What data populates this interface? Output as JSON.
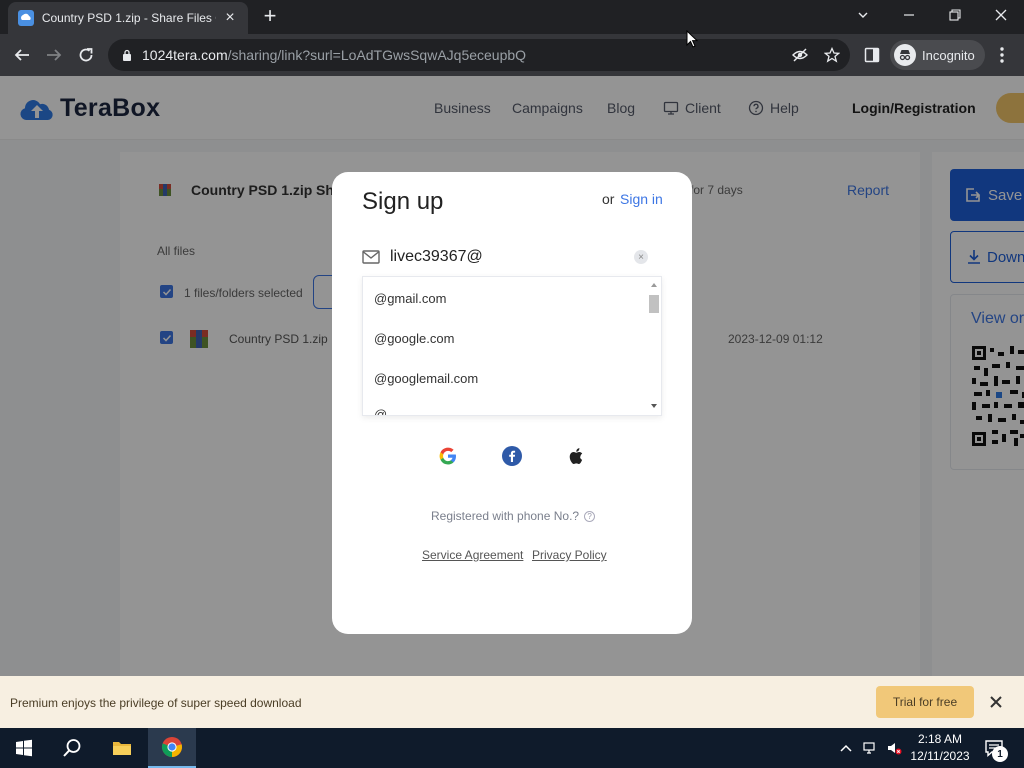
{
  "browser": {
    "tab_title": "Country PSD 1.zip - Share Files O",
    "url_host": "1024tera.com",
    "url_path": "/sharing/link?surl=LoAdTGwsSqwAJq5eceupbQ",
    "profile_label": "Incognito"
  },
  "site": {
    "brand": "TeraBox",
    "nav": {
      "business": "Business",
      "campaigns": "Campaigns",
      "blog": "Blog",
      "client": "Client",
      "help": "Help"
    },
    "login": "Login/Registration"
  },
  "share": {
    "file_title": "Country PSD 1.zip",
    "file_title_tail": "Sh",
    "expiry": "for 7 days",
    "report": "Report",
    "all_files": "All files",
    "selection": "1 files/folders selected",
    "rows": [
      {
        "name": "Country PSD 1.zip",
        "date": "2023-12-09 01:12"
      }
    ],
    "save_label": "Save",
    "download_label": "Down",
    "view_on_label": "View or"
  },
  "signup": {
    "title": "Sign up",
    "or": "or",
    "signin": "Sign in",
    "email_value": "livec39367@",
    "suggestions": [
      "@gmail.com",
      "@google.com",
      "@googlemail.com",
      "@..."
    ],
    "phone_registered": "Registered with phone No.?",
    "service_agreement": "Service Agreement",
    "privacy_policy": "Privacy Policy"
  },
  "promo": {
    "text": "Premium enjoys the privilege of super speed download",
    "trial": "Trial for free"
  },
  "taskbar": {
    "time": "2:18 AM",
    "date": "12/11/2023",
    "notification_count": "1"
  },
  "colors": {
    "accent": "#3d76e4",
    "save_blue": "#1e5fd9",
    "promo_bg": "#f7efe1",
    "trial_btn": "#f1c879"
  },
  "icons": [
    "terabox-logo-icon",
    "mail-icon",
    "google-icon",
    "facebook-icon",
    "apple-icon",
    "close-icon",
    "windows-start-icon",
    "search-icon",
    "file-explorer-icon",
    "chrome-icon"
  ]
}
